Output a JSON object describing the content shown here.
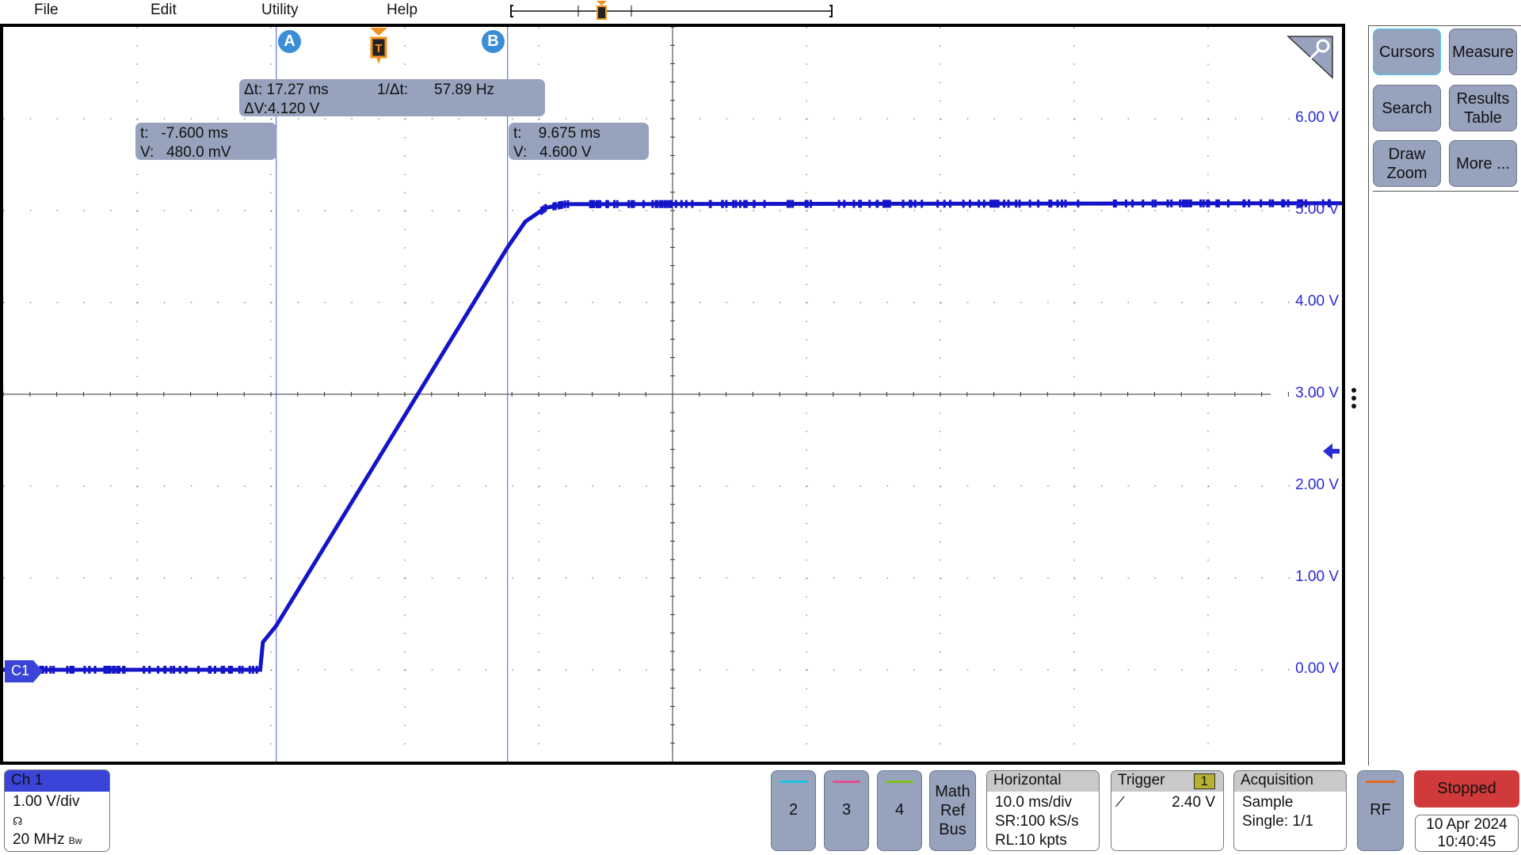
{
  "menu": {
    "items": [
      "File",
      "Edit",
      "Utility",
      "Help"
    ]
  },
  "cursors": {
    "a_label": "A",
    "b_label": "B",
    "trigger_label": "T",
    "delta_t": "Δt: 17.27 ms",
    "inv_delta_t_label": "1/Δt:",
    "inv_delta_t": "57.89 Hz",
    "delta_v": "ΔV:4.120 V",
    "a_t": "t:   -7.600 ms",
    "a_v": "V:   480.0 mV",
    "b_t": "t:    9.675 ms",
    "b_v": "V:   4.600 V"
  },
  "right_panel": {
    "buttons": [
      "Cursors",
      "Measure",
      "Search",
      "Results Table",
      "Draw Zoom",
      "More ..."
    ]
  },
  "channel": {
    "label": "Ch 1",
    "marker": "C1",
    "scale": "1.00 V/div",
    "bandwidth": "20 MHz",
    "bw_badge": "Bw",
    "probe_icon": "probe-icon"
  },
  "bottom": {
    "ch_buttons": [
      {
        "label": "2",
        "color": "#19c3e0"
      },
      {
        "label": "3",
        "color": "#e0508a"
      },
      {
        "label": "4",
        "color": "#7bbf1a"
      }
    ],
    "math_ref_bus": [
      "Math",
      "Ref",
      "Bus"
    ],
    "horizontal": {
      "title": "Horizontal",
      "lines": [
        "10.0 ms/div",
        "SR:100 kS/s",
        "RL:10 kpts"
      ]
    },
    "trigger": {
      "title": "Trigger",
      "source": "1",
      "level": "2.40 V",
      "slope": "rising"
    },
    "acquisition": {
      "title": "Acquisition",
      "lines": [
        "Sample",
        "Single: 1/1"
      ]
    },
    "rf": {
      "label": "RF",
      "color": "#e06a1a"
    },
    "status": "Stopped",
    "status_color": "#d03a3a",
    "date": "10 Apr 2024",
    "time": "10:40:45"
  },
  "colors": {
    "waveform": "#1414c8",
    "axis_labels": "#2b2bd6",
    "ch1": "#3a44d8",
    "cursor": "#4a5ad8",
    "trigger": "#f39020"
  },
  "chart_data": {
    "type": "line",
    "xlim": [
      -28,
      72
    ],
    "ylim": [
      -1,
      7
    ],
    "y_tick_labels": [
      "6.00 V",
      "5.00 V",
      "4.00 V",
      "3.00 V",
      "2.00 V",
      "1.00 V",
      "0.00 V"
    ],
    "y_tick_values": [
      6,
      5,
      4,
      3,
      2,
      1,
      0
    ],
    "grid": true,
    "series": [
      {
        "name": "Ch 1",
        "points": [
          [
            -28,
            0.0
          ],
          [
            -8.8,
            0.0
          ],
          [
            -8.6,
            0.3
          ],
          [
            -7.6,
            0.48
          ],
          [
            9.675,
            4.6
          ],
          [
            11,
            4.88
          ],
          [
            12.5,
            5.03
          ],
          [
            14,
            5.07
          ],
          [
            72,
            5.08
          ]
        ]
      }
    ],
    "cursor_a": {
      "t": -7.6,
      "v": 0.48
    },
    "cursor_b": {
      "t": 9.675,
      "v": 4.6
    },
    "trigger_level": 2.4
  }
}
